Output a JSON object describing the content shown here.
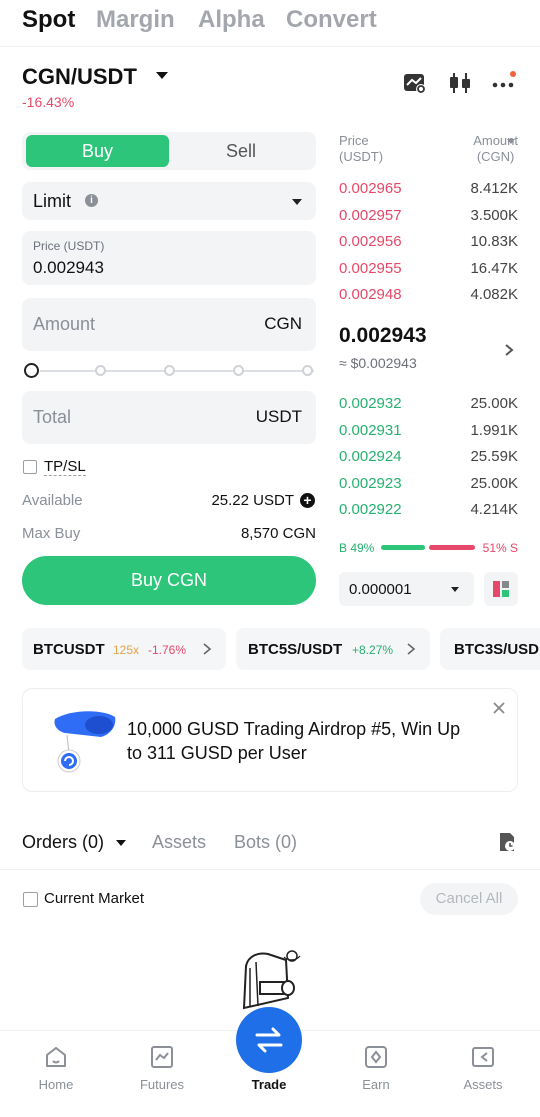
{
  "top_tabs": [
    "Spot",
    "Margin",
    "Alpha",
    "Convert"
  ],
  "pair": {
    "name": "CGN/USDT",
    "change": "-16.43%"
  },
  "order_form": {
    "buy_label": "Buy",
    "sell_label": "Sell",
    "order_type": "Limit",
    "price_label": "Price (USDT)",
    "price_value": "0.002943",
    "amount_placeholder": "Amount",
    "amount_unit": "CGN",
    "slider_level": 0,
    "total_placeholder": "Total",
    "total_unit": "USDT",
    "tpsl_label": "TP/SL",
    "available_label": "Available",
    "available_value": "25.22 USDT",
    "maxbuy_label": "Max Buy",
    "maxbuy_value": "8,570 CGN",
    "submit_label": "Buy CGN"
  },
  "orderbook": {
    "price_header": "Price\n(USDT)",
    "amount_header": "Amount\n(CGN)",
    "asks": [
      {
        "price": "0.002965",
        "amount": "8.412K"
      },
      {
        "price": "0.002957",
        "amount": "3.500K"
      },
      {
        "price": "0.002956",
        "amount": "10.83K"
      },
      {
        "price": "0.002955",
        "amount": "16.47K"
      },
      {
        "price": "0.002948",
        "amount": "4.082K"
      }
    ],
    "last_price": "0.002943",
    "last_price_usd": "≈ $0.002943",
    "bids": [
      {
        "price": "0.002932",
        "amount": "25.00K"
      },
      {
        "price": "0.002931",
        "amount": "1.991K"
      },
      {
        "price": "0.002924",
        "amount": "25.59K"
      },
      {
        "price": "0.002923",
        "amount": "25.00K"
      },
      {
        "price": "0.002922",
        "amount": "4.214K"
      }
    ],
    "buy_ratio": "B 49%",
    "sell_ratio": "51% S",
    "buy_pct": 49,
    "precision": "0.000001"
  },
  "tickers": [
    {
      "symbol": "BTCUSDT",
      "leverage": "125x",
      "change": "-1.76%"
    },
    {
      "symbol": "BTC5S/USDT",
      "change": "+8.27%"
    },
    {
      "symbol": "BTC3S/USD"
    }
  ],
  "banner": {
    "text": "10,000 GUSD Trading Airdrop #5, Win Up to 311 GUSD per User"
  },
  "orders": {
    "tabs": [
      "Orders (0)",
      "Assets",
      "Bots (0)"
    ],
    "current_market_label": "Current Market",
    "cancel_all_label": "Cancel All"
  },
  "nav": [
    "Home",
    "Futures",
    "Trade",
    "Earn",
    "Assets"
  ],
  "colors": {
    "buy": "#2cc57a",
    "sell": "#e54868",
    "nav_trade": "#1f6fe8"
  }
}
